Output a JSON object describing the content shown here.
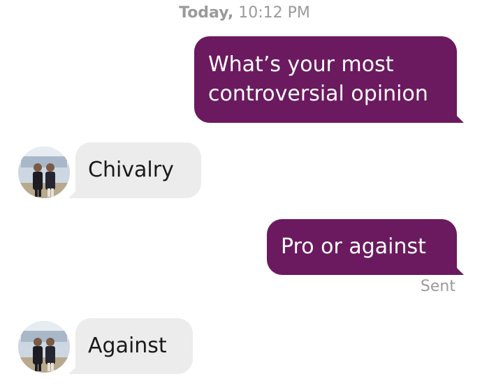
{
  "header": {
    "day": "Today,",
    "time": "10:12 PM"
  },
  "messages": [
    {
      "direction": "sent",
      "text_line1": "What’s your most",
      "text_line2": "controversial opinion"
    },
    {
      "direction": "received",
      "text": "Chivalry"
    },
    {
      "direction": "sent",
      "text": "Pro or against"
    },
    {
      "direction": "received",
      "text": "Against"
    }
  ],
  "status": "Sent",
  "colors": {
    "sent_bubble": "#6b1a5f",
    "received_bubble": "#ececec",
    "meta_text": "#9a9a9a"
  }
}
